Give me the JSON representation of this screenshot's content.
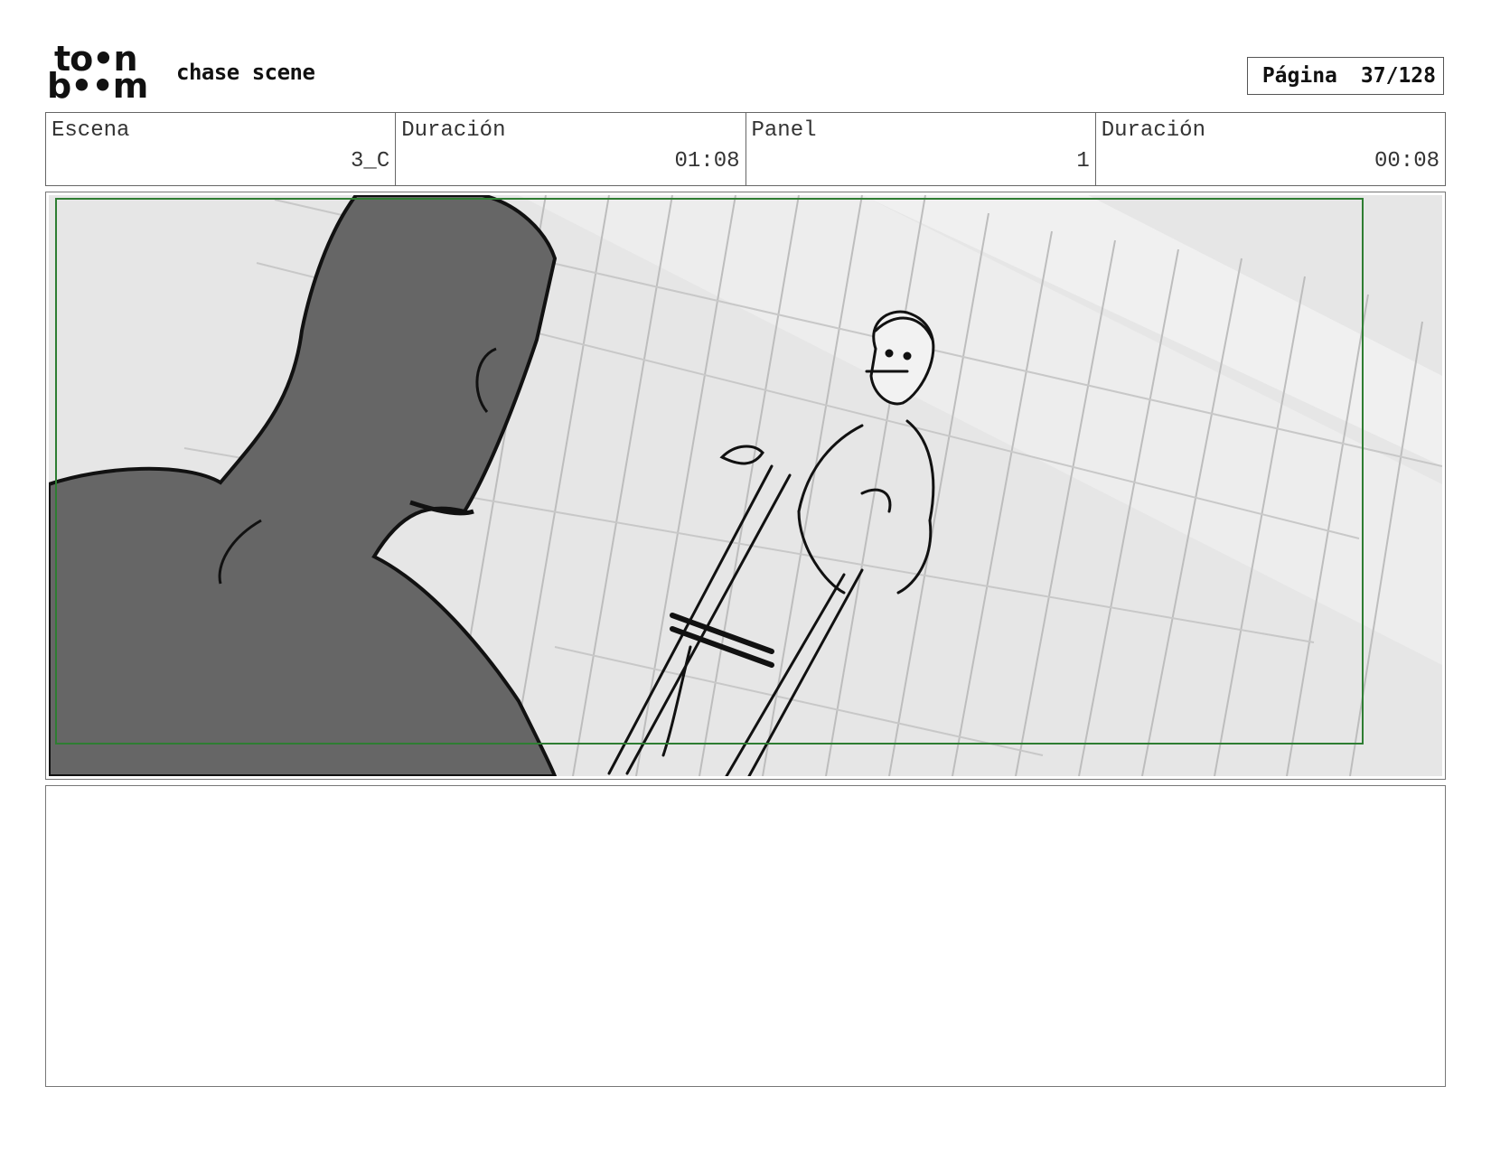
{
  "header": {
    "logo_top": "to•n",
    "logo_bottom": "b••m",
    "project_title": "chase scene",
    "page_label": "Página",
    "page_value": "37/128"
  },
  "info": {
    "scene_label": "Escena",
    "scene_value": "3_C",
    "scene_duration_label": "Duración",
    "scene_duration_value": "01:08",
    "panel_label": "Panel",
    "panel_value": "1",
    "panel_duration_label": "Duración",
    "panel_duration_value": "00:08"
  },
  "notes": {
    "text": ""
  },
  "colors": {
    "safe_frame": "#2e7d32",
    "silhouette": "#666666",
    "background_sketch": "#e4e4e4"
  }
}
